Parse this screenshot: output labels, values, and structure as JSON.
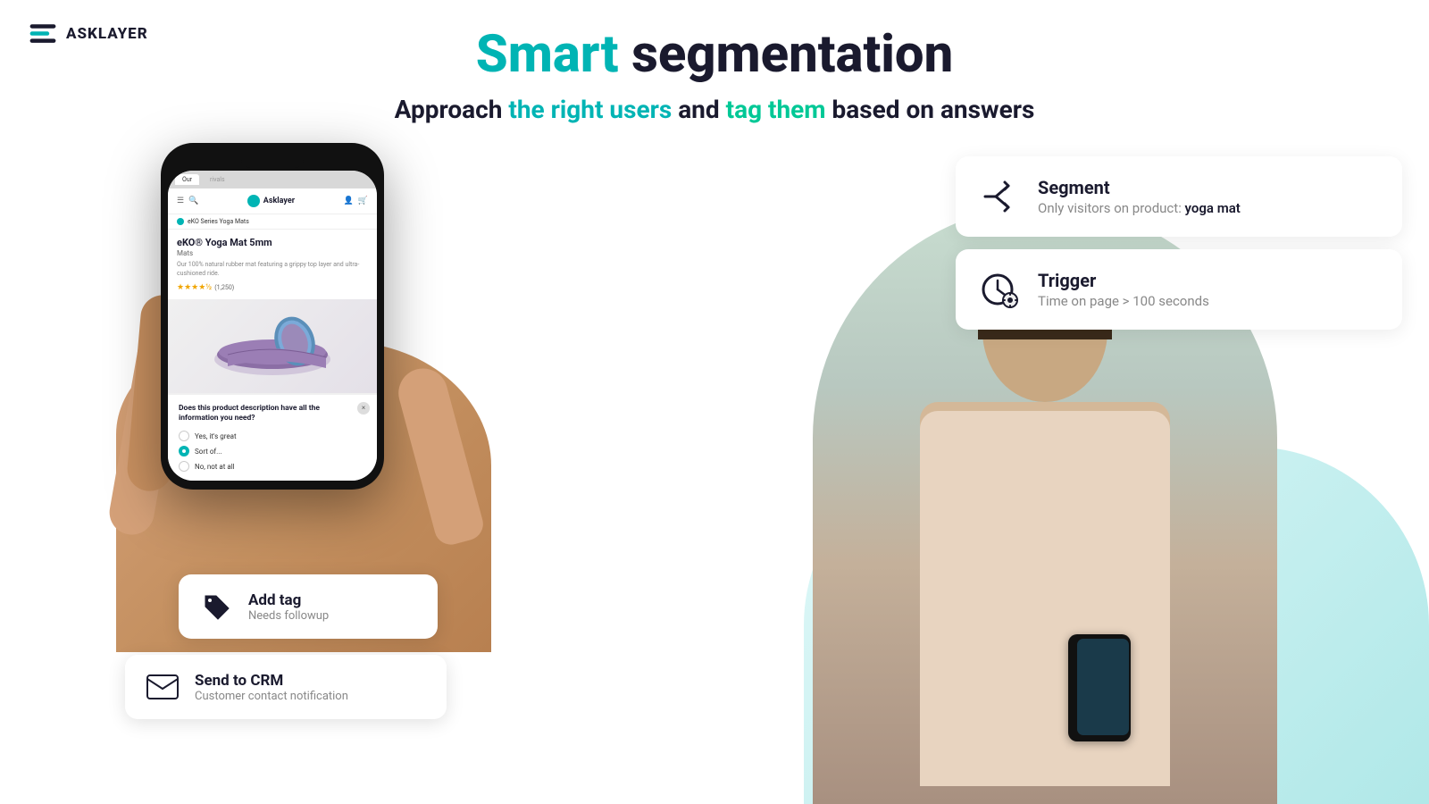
{
  "logo": {
    "text": "ASKLAYER",
    "icon_alt": "asklayer-logo"
  },
  "header": {
    "main_title_part1": "Smart ",
    "main_title_part2": "segmentation",
    "subtitle_part1": "Approach ",
    "subtitle_highlight1": "the right users",
    "subtitle_part2": " and ",
    "subtitle_highlight2": "tag them",
    "subtitle_part3": " based on answers"
  },
  "phone": {
    "browser_tab_active": "Our",
    "browser_tab_inactive": "rivals",
    "nav_brand": "Asklayer",
    "breadcrumb": "eKO Series Yoga Mats",
    "product_name": "eKO® Yoga Mat 5mm",
    "product_type": "Mats",
    "product_desc": "Our 100% natural rubber mat featuring a grippy top layer and ultra-cushioned ride.",
    "stars": "★★★★½",
    "review_count": "(1,250)",
    "survey_question": "Does this product description have all the information you need?",
    "options": [
      {
        "label": "Yes, it's great",
        "selected": false
      },
      {
        "label": "Sort of...",
        "selected": true
      },
      {
        "label": "No, not at all",
        "selected": false
      }
    ]
  },
  "add_tag_card": {
    "label": "Add tag",
    "sublabel": "Needs followup",
    "icon": "tag-icon"
  },
  "crm_card": {
    "label": "Send to CRM",
    "sublabel": "Customer contact notification",
    "icon": "mail-icon"
  },
  "segment_card": {
    "title": "Segment",
    "description_prefix": "Only visitors on product: ",
    "description_highlight": "yoga mat",
    "icon": "segment-icon"
  },
  "trigger_card": {
    "title": "Trigger",
    "description": "Time on page > 100 seconds",
    "icon": "trigger-icon"
  }
}
